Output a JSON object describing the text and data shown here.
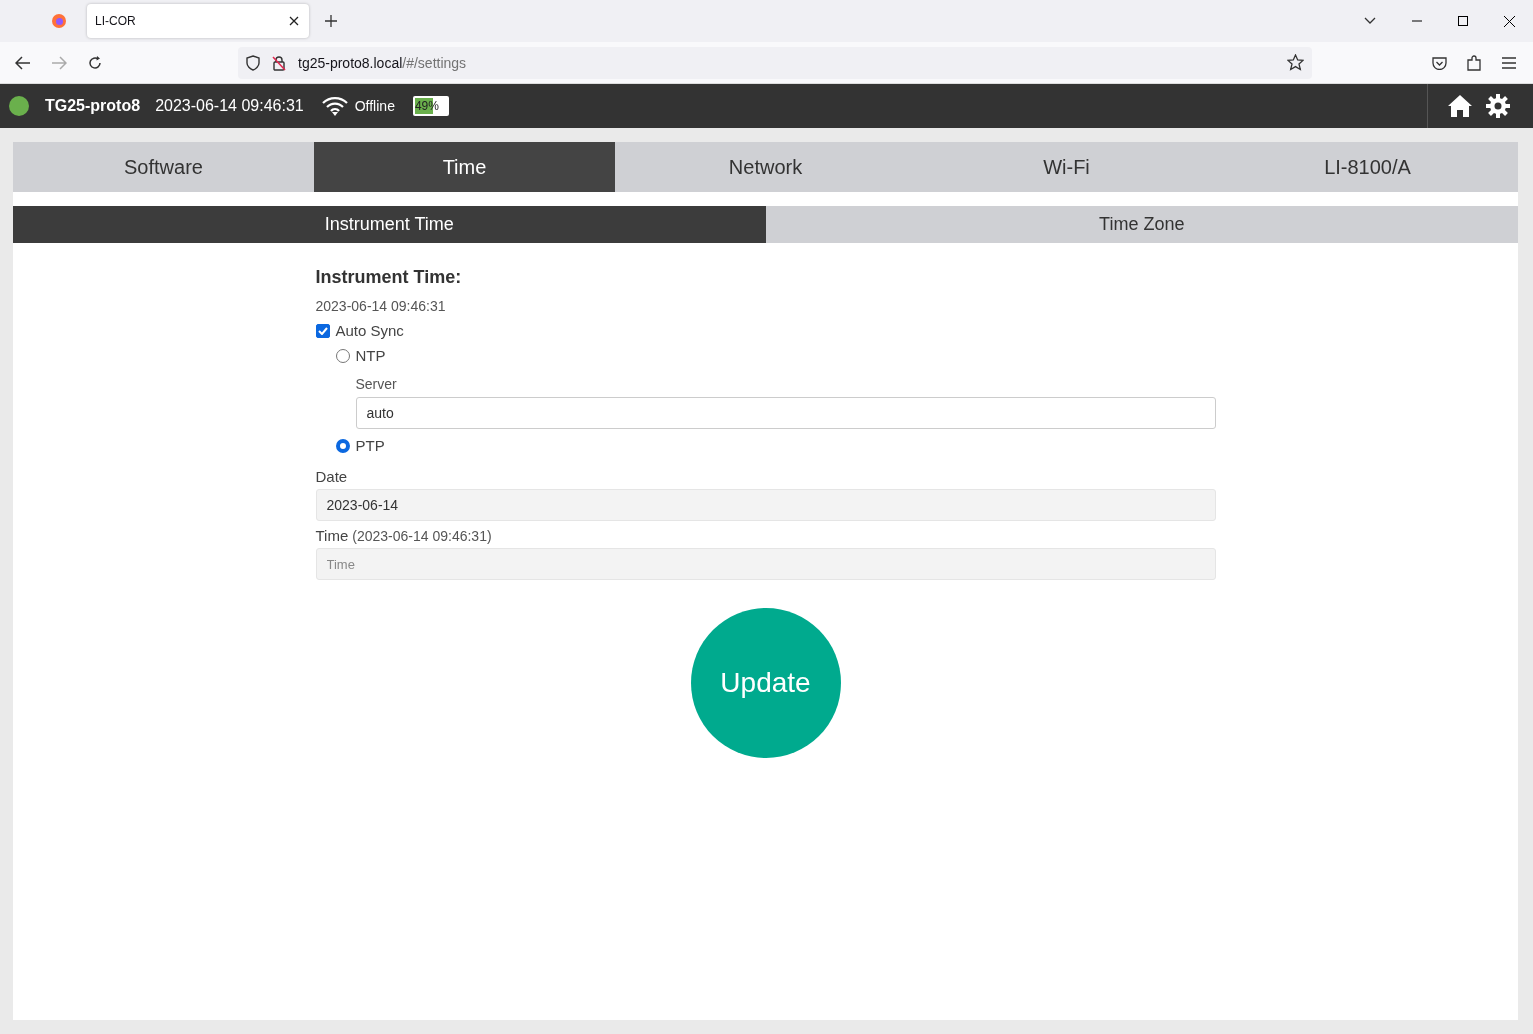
{
  "browser": {
    "tabs": [
      {
        "title": "LI-COR",
        "selected": true
      }
    ],
    "url_host": "tg25-proto8.local",
    "url_path": "/#/settings"
  },
  "header": {
    "device": "TG25-proto8",
    "datetime": "2023-06-14 09:46:31",
    "network": "Offline",
    "battery": {
      "label": "49%",
      "level": 0.49
    }
  },
  "tabs": [
    {
      "label": "Software",
      "selected": false
    },
    {
      "label": "Time",
      "selected": true
    },
    {
      "label": "Network",
      "selected": false
    },
    {
      "label": "Wi-Fi",
      "selected": false
    },
    {
      "label": "LI-8100/A",
      "selected": false
    }
  ],
  "subtabs": [
    {
      "label": "Instrument Time",
      "selected": true
    },
    {
      "label": "Time Zone",
      "selected": false
    }
  ],
  "form": {
    "heading": "Instrument Time:",
    "current": "2023-06-14 09:46:31",
    "auto_sync": {
      "label": "Auto Sync",
      "checked": true
    },
    "sync_options": [
      {
        "label": "NTP",
        "selected": false
      },
      {
        "label": "PTP",
        "selected": true
      }
    ],
    "server": {
      "label": "Server",
      "value": "auto"
    },
    "date": {
      "label": "Date",
      "value": "2023-06-14"
    },
    "time": {
      "label": "Time",
      "hint": "(2023-06-14 09:46:31)",
      "placeholder": "Time"
    },
    "button": "Update"
  }
}
